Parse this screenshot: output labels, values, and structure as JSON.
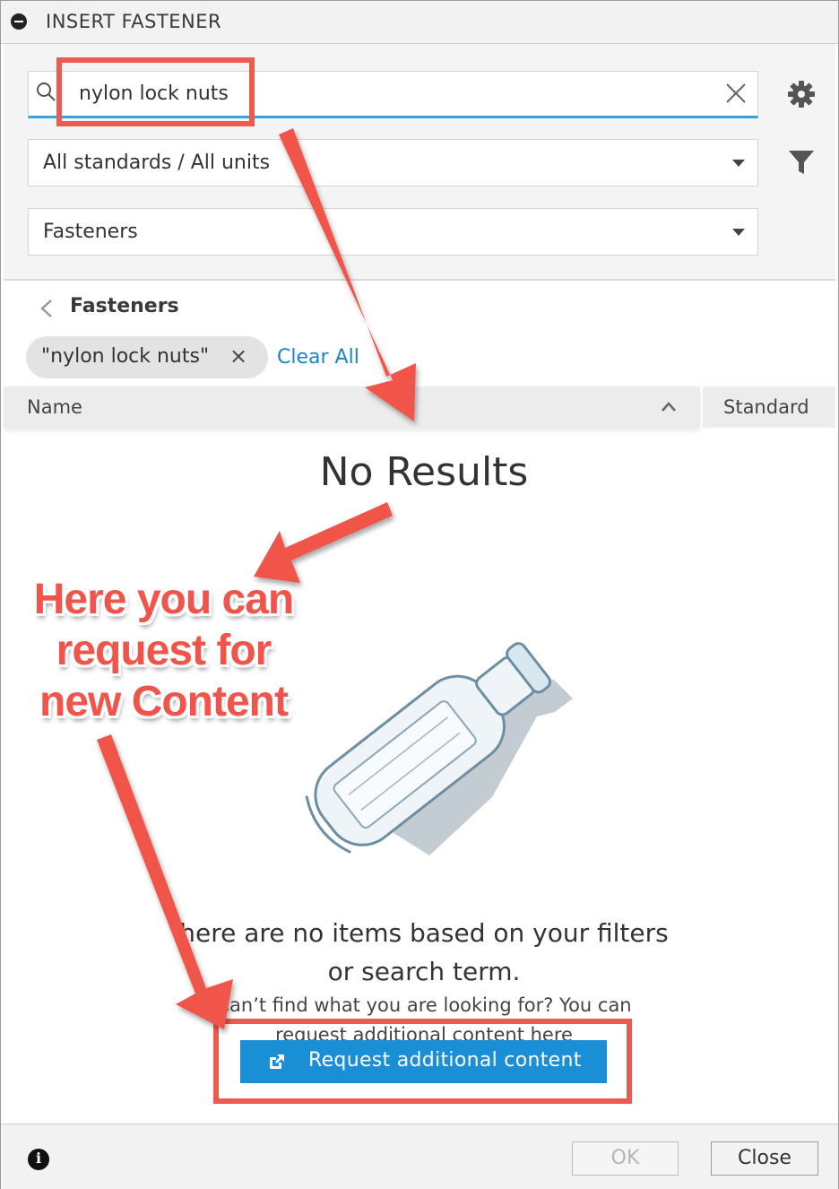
{
  "window": {
    "title": "INSERT FASTENER"
  },
  "search": {
    "value": "nylon lock nuts",
    "icon": "search-icon",
    "clear_icon": "close-icon"
  },
  "toolbar": {
    "settings_icon": "gear-icon",
    "filter_icon": "filter-icon"
  },
  "filters": {
    "standards": "All standards / All units",
    "category": "Fasteners"
  },
  "breadcrumb": {
    "label": "Fasteners"
  },
  "chip": {
    "label": "\"nylon lock nuts\"",
    "remove": "×"
  },
  "clear_all": "Clear All",
  "table": {
    "columns": [
      "Name",
      "Standard"
    ]
  },
  "empty_state": {
    "title": "No Results",
    "message_line1": "here are no items based on your filters",
    "message_line2": "or search term.",
    "hint_line1": "Can’t find what you are looking for? You can",
    "hint_line2": "request additional content here",
    "button_label": "Request additional content"
  },
  "footer": {
    "ok_label": "OK",
    "close_label": "Close"
  },
  "annotation": {
    "line1": "Here you can",
    "line2": "request for",
    "line3": "new Content",
    "color": "#ec5a50"
  },
  "colors": {
    "accent": "#1a8fd6",
    "link": "#1a86c7",
    "search_underline": "#3aa0d8"
  }
}
